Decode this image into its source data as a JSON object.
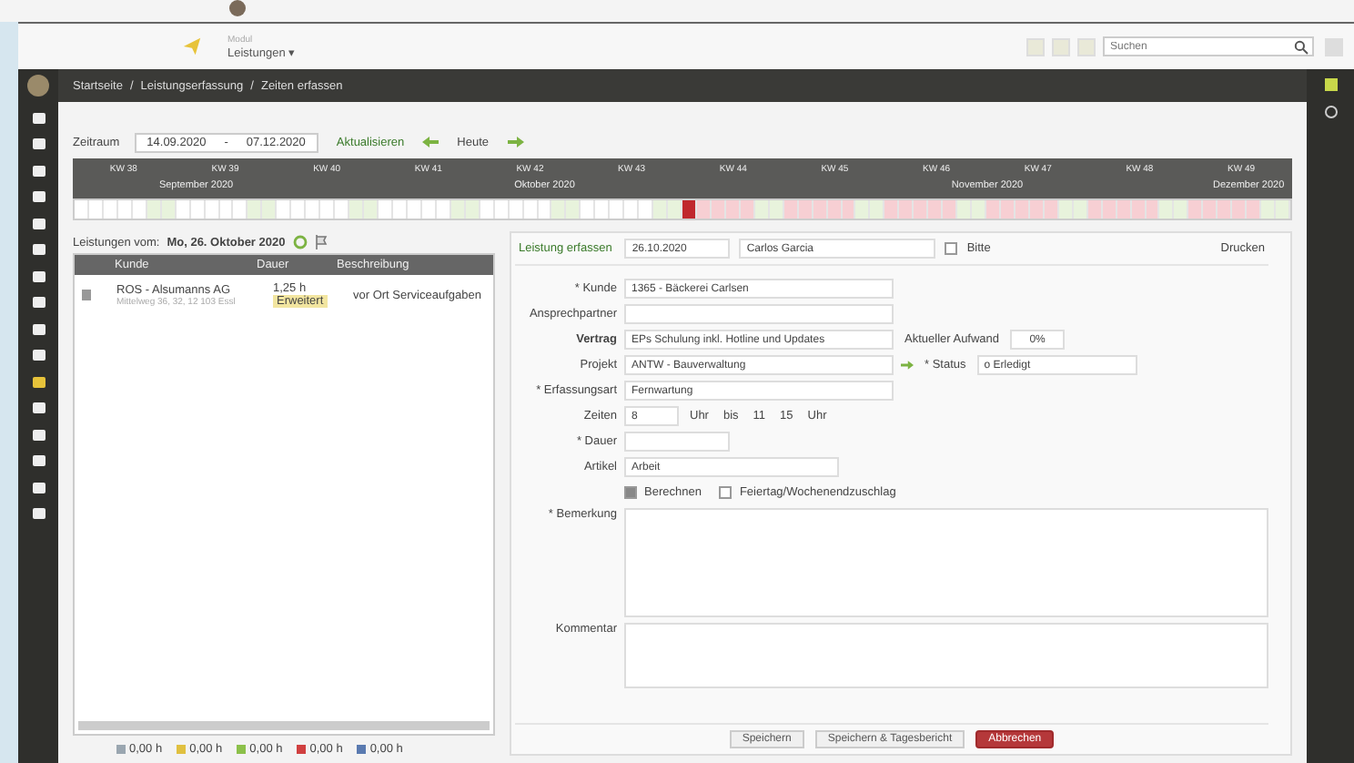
{
  "header": {
    "app_caption": "Modul",
    "app_switcher": "Leistungen ▾",
    "search": {
      "placeholder": "Suchen"
    }
  },
  "breadcrumb": {
    "separator": "/",
    "items": [
      "Startseite",
      "Leistungserfassung",
      "Zeiten erfassen"
    ]
  },
  "nav": [
    {
      "selected": false
    },
    {
      "selected": false
    },
    {
      "selected": false
    },
    {
      "selected": false
    },
    {
      "selected": false
    },
    {
      "selected": false
    },
    {
      "selected": false
    },
    {
      "selected": false
    },
    {
      "selected": false
    },
    {
      "selected": false
    },
    {
      "selected": true
    },
    {
      "selected": false
    },
    {
      "selected": false
    },
    {
      "selected": false
    },
    {
      "selected": false
    },
    {
      "selected": false
    }
  ],
  "toolbar": {
    "label": "Zeitraum",
    "from": "14.09.2020",
    "to": "07.12.2020",
    "separator": "-",
    "refresh": "Aktualisieren",
    "today": "Heute"
  },
  "timeline": {
    "weeks": [
      "KW 38",
      "KW 39",
      "KW 40",
      "KW 41",
      "KW 42",
      "KW 43",
      "KW 44",
      "KW 45",
      "KW 46",
      "KW 47",
      "KW 48",
      "KW 49"
    ],
    "months": [
      "September 2020",
      "Oktober 2020",
      "November 2020",
      "Dezember 2020"
    ]
  },
  "list": {
    "title": "Leistungen vom:",
    "date": "Mo, 26. Oktober 2020",
    "columns": [
      "Kunde",
      "Dauer",
      "Beschreibung"
    ],
    "rows": [
      {
        "customer": "ROS - Alsumanns AG",
        "address": "Mittelweg 36, 32, 12 103 Essl",
        "duration": "1,25 h",
        "type": "Erweitert",
        "description": "vor Ort Serviceaufgaben"
      }
    ]
  },
  "legend": [
    {
      "text": "0,00 h",
      "color": "#9aa6b0"
    },
    {
      "text": "0,00 h",
      "color": "#e0c040"
    },
    {
      "text": "0,00 h",
      "color": "#8cc04a"
    },
    {
      "text": "0,00 h",
      "color": "#d04040"
    },
    {
      "text": "0,00 h",
      "color": "#5a7ab0"
    }
  ],
  "form": {
    "title": "Leistung erfassen",
    "date": "26.10.2020",
    "employee": "Carlos Garcia",
    "flag": {
      "label": "Bitte",
      "checked": false
    },
    "print": "Drucken",
    "fields": [
      {
        "kind": "select",
        "label": "* Kunde",
        "value": "1365 - Bäckerei Carlsen",
        "bold": false
      },
      {
        "kind": "select",
        "label": "Ansprechpartner",
        "bold": false
      },
      {
        "kind": "select",
        "label": "Vertrag",
        "value": "EPs Schulung inkl. Hotline und Updates",
        "bold": true,
        "aside": {
          "label": "Aktueller Aufwand",
          "value": "0%"
        }
      },
      {
        "kind": "select",
        "label": "Projekt",
        "value": "ANTW - Bauverwaltung",
        "bold": false,
        "status": {
          "label": "* Status",
          "value": "o Erledigt"
        }
      },
      {
        "kind": "select",
        "label": "* Erfassungsart",
        "value": "Fernwartung",
        "bold": false
      },
      {
        "kind": "times",
        "label": "Zeiten",
        "value": "8",
        "parts": [
          "Uhr",
          "bis",
          "11",
          "15",
          "Uhr"
        ],
        "bold": false
      },
      {
        "kind": "short",
        "label": "* Dauer",
        "bold": false
      },
      {
        "kind": "medium",
        "label": "Artikel",
        "value": "Arbeit",
        "bold": false
      },
      {
        "kind": "checks",
        "checks": [
          {
            "label": "Berechnen",
            "checked": true
          },
          {
            "label": "Feiertag/Wochenendzuschlag",
            "checked": false
          }
        ]
      },
      {
        "kind": "textarea",
        "label": "* Bemerkung",
        "bold": false
      },
      {
        "kind": "textarea-small",
        "label": "Kommentar",
        "bold": false
      }
    ],
    "buttons": [
      {
        "label": "Speichern",
        "kind": "save"
      },
      {
        "label": "Speichern & Tagesbericht",
        "kind": "save"
      },
      {
        "label": "Abbrechen",
        "kind": "cancel"
      }
    ]
  }
}
